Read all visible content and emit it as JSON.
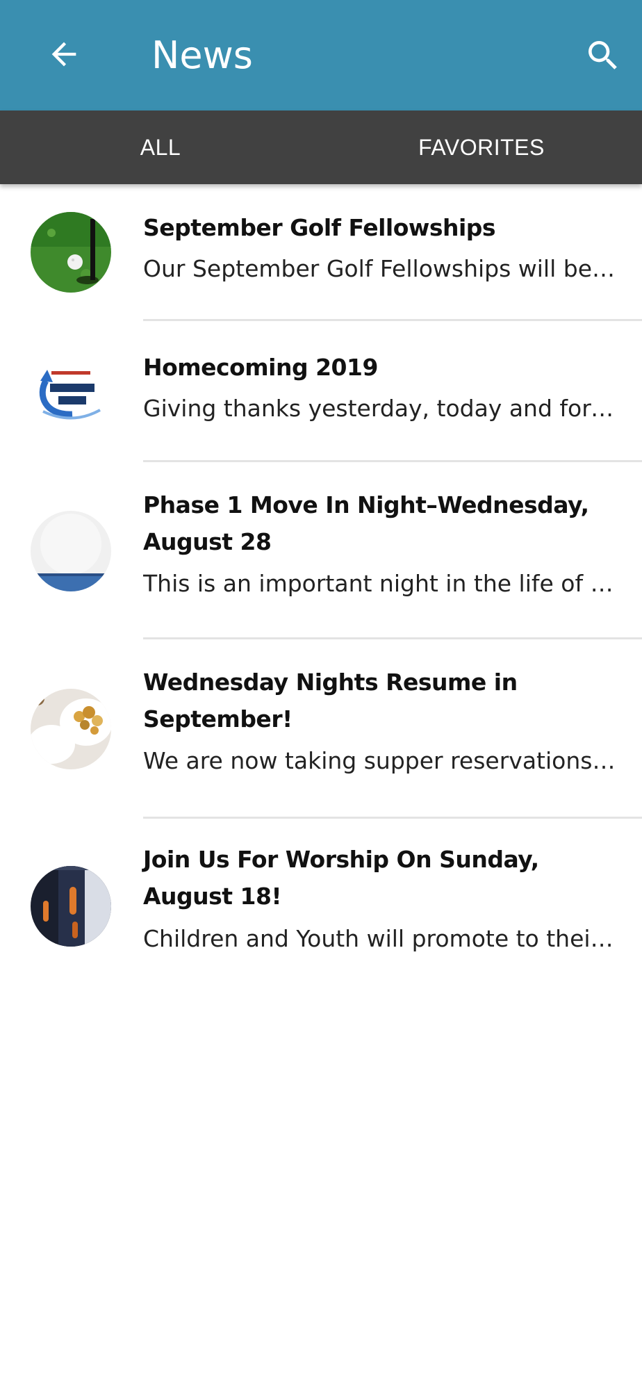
{
  "header": {
    "title": "News",
    "background": "#3a8fb0",
    "back_icon": "arrow-left-icon",
    "search_icon": "search-icon"
  },
  "tabs": [
    {
      "label": "ALL"
    },
    {
      "label": "FAVORITES"
    }
  ],
  "items": [
    {
      "title": "September Golf Fellowships",
      "description": "Our September Golf Fellowships will be held on",
      "thumbnail": "golf-ball-thumbnail"
    },
    {
      "title": "Homecoming 2019",
      "description": "Giving thanks yesterday, today and forever",
      "thumbnail": "homecoming-logo-thumbnail"
    },
    {
      "title": "Phase 1 Move In Night–Wednesday, August 28",
      "description": "This is an important night in the life of our church",
      "thumbnail": "move-in-thumbnail"
    },
    {
      "title": "Wednesday Nights Resume in September!",
      "description": "We are now taking supper reservations for",
      "thumbnail": "supper-food-thumbnail"
    },
    {
      "title": "Join Us For Worship On Sunday, August 18!",
      "description": "Children and Youth will promote to their new",
      "thumbnail": "worship-thumbnail"
    }
  ]
}
